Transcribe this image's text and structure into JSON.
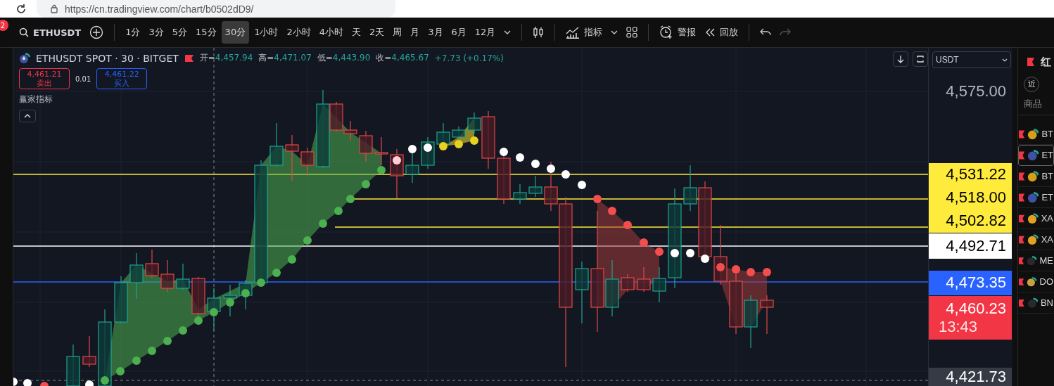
{
  "browser": {
    "url": "https://cn.tradingview.com/chart/b0502dD9/"
  },
  "toolbar": {
    "notification_count": "2",
    "symbol": "ETHUSDT",
    "timeframes": [
      {
        "label": "1分",
        "selected": false
      },
      {
        "label": "3分",
        "selected": false
      },
      {
        "label": "5分",
        "selected": false
      },
      {
        "label": "15分",
        "selected": false
      },
      {
        "label": "30分",
        "selected": true
      },
      {
        "label": "1小时",
        "selected": false
      },
      {
        "label": "2小时",
        "selected": false
      },
      {
        "label": "4小时",
        "selected": false
      },
      {
        "label": "天",
        "selected": false
      },
      {
        "label": "2天",
        "selected": false
      },
      {
        "label": "周",
        "selected": false
      },
      {
        "label": "月",
        "selected": false
      },
      {
        "label": "3月",
        "selected": false
      },
      {
        "label": "6月",
        "selected": false
      },
      {
        "label": "12月",
        "selected": false
      }
    ],
    "indicators_label": "指标",
    "alert_label": "警报",
    "replay_label": "回放"
  },
  "legend": {
    "title": "ETHUSDT SPOT · 30 · BITGET",
    "ohlc": [
      {
        "label": "开=",
        "value": "4,457.94"
      },
      {
        "label": "高=",
        "value": "4,471.07"
      },
      {
        "label": "低=",
        "value": "4,443.90"
      },
      {
        "label": "收=",
        "value": "4,465.67"
      }
    ],
    "change": "+7.73 (+0.17%)"
  },
  "trade": {
    "sell_price": "4,461.21",
    "sell_label": "卖出",
    "quantity": "0.01",
    "buy_price": "4,461.22",
    "buy_label": "买入"
  },
  "indicator": {
    "name": "赢家指标"
  },
  "chart_controls": {
    "currency": "USDT"
  },
  "price_axis": [
    {
      "kind": "tick",
      "label": "4,575.00"
    },
    {
      "kind": "level",
      "label": "4,531.22",
      "color": "#ffeb3b"
    },
    {
      "kind": "level",
      "label": "4,518.00",
      "color": "#ffeb3b"
    },
    {
      "kind": "level",
      "label": "4,502.82",
      "color": "#ffeb3b"
    },
    {
      "kind": "level",
      "label": "4,492.71",
      "color": "#ffffff"
    },
    {
      "kind": "level",
      "label": "4,473.35",
      "color": "#2962ff"
    },
    {
      "kind": "level",
      "label": "4,460.23",
      "sublabel": "13:43",
      "color": "#f23645"
    },
    {
      "kind": "crosshair",
      "label": "4,421.73"
    }
  ],
  "watchlist": {
    "title": "红",
    "recent_button": "近",
    "column_header": "商品",
    "items": [
      {
        "symbol": "BT",
        "color": "#d4a017",
        "selected": false
      },
      {
        "symbol": "ET",
        "color": "#3f51a5",
        "selected": true
      },
      {
        "symbol": "BT",
        "color": "#d4a017",
        "selected": false
      },
      {
        "symbol": "ET",
        "color": "#3f51a5",
        "selected": false
      },
      {
        "symbol": "XA",
        "color": "#e0a020",
        "selected": false
      },
      {
        "symbol": "XA",
        "color": "#e0a020",
        "selected": false
      },
      {
        "symbol": "ME",
        "color": "#2a2a2a",
        "selected": false
      },
      {
        "symbol": "DO",
        "color": "#c8a040",
        "selected": false
      },
      {
        "symbol": "BN",
        "color": "#2a2a2a",
        "selected": false
      }
    ]
  }
}
